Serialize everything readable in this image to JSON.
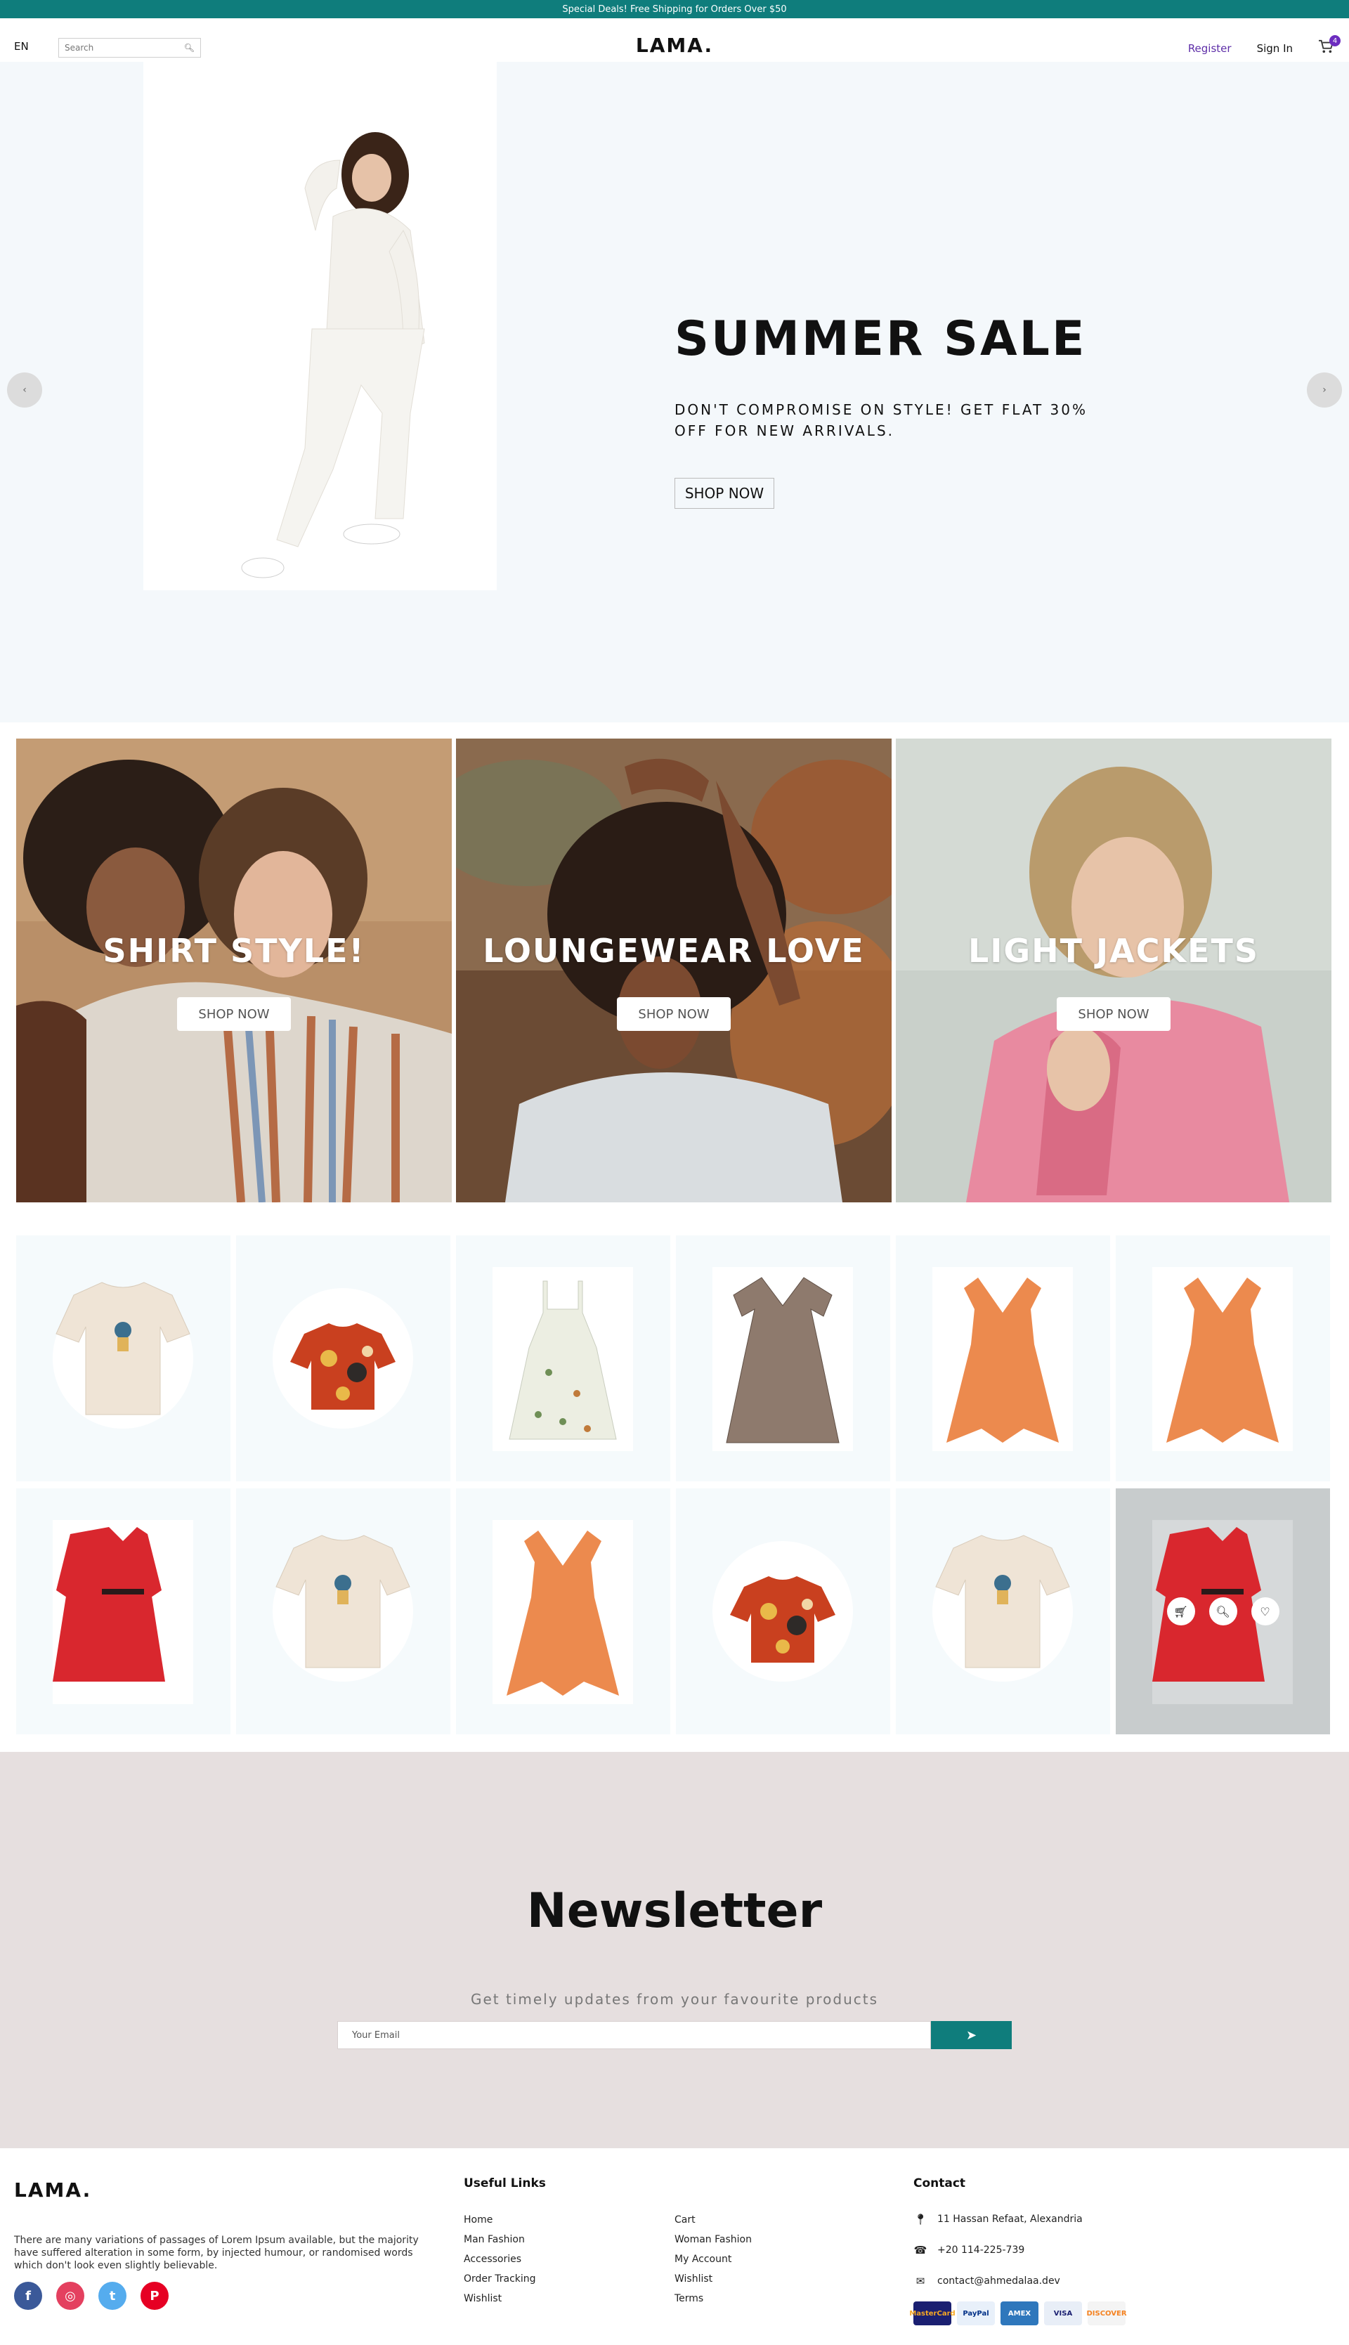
{
  "announcement": "Special Deals! Free Shipping for Orders Over $50",
  "nav": {
    "language": "EN",
    "search_placeholder": "Search",
    "logo": "LAMA.",
    "register": "Register",
    "sign_in": "Sign In",
    "cart_count": "4"
  },
  "hero": {
    "title": "SUMMER SALE",
    "description": "DON'T COMPROMISE ON STYLE! GET FLAT 30% OFF FOR NEW ARRIVALS.",
    "button": "SHOP NOW"
  },
  "categories": [
    {
      "title": "SHIRT STYLE!",
      "button": "SHOP NOW"
    },
    {
      "title": "LOUNGEWEAR LOVE",
      "button": "SHOP NOW"
    },
    {
      "title": "LIGHT JACKETS",
      "button": "SHOP NOW"
    }
  ],
  "products": [
    {
      "icon": "tshirt-product",
      "shape": "circle"
    },
    {
      "icon": "hawaiian-shirt-product",
      "shape": "circle"
    },
    {
      "icon": "floral-dress-product",
      "shape": "square"
    },
    {
      "icon": "printed-wrap-dress-product",
      "shape": "square"
    },
    {
      "icon": "orange-dress-product",
      "shape": "square"
    },
    {
      "icon": "orange-dress-product",
      "shape": "square"
    },
    {
      "icon": "red-coat-dress-product",
      "shape": "square"
    },
    {
      "icon": "tshirt-product",
      "shape": "circle"
    },
    {
      "icon": "orange-dress-product",
      "shape": "square"
    },
    {
      "icon": "hawaiian-shirt-product",
      "shape": "circle"
    },
    {
      "icon": "tshirt-product",
      "shape": "circle"
    },
    {
      "icon": "red-coat-dress-product",
      "shape": "square"
    }
  ],
  "newsletter": {
    "title": "Newsletter",
    "description": "Get timely updates from your favourite products",
    "email_placeholder": "Your Email"
  },
  "footer": {
    "logo": "LAMA.",
    "description": "There are many variations of passages of Lorem Ipsum available, but the majority have suffered alteration in some form, by injected humour, or randomised words which don't look even slightly believable.",
    "useful_links_title": "Useful Links",
    "links": [
      "Home",
      "Cart",
      "Man Fashion",
      "Woman Fashion",
      "Accessories",
      "My Account",
      "Order Tracking",
      "Wishlist",
      "Wishlist",
      "Terms"
    ],
    "contact_title": "Contact",
    "address": "11 Hassan Refaat, Alexandria",
    "phone": "+20 114-225-739",
    "email": "contact@ahmedalaa.dev",
    "payments": [
      "MasterCard",
      "PayPal",
      "AMEX",
      "VISA",
      "DISCOVER"
    ]
  },
  "colors": {
    "teal": "#0f7d7c",
    "purple": "#6c2cbf",
    "hero_bg": "#f4f8fb",
    "newsletter_bg": "#e6dfdf",
    "product_bg": "#f5fafc"
  }
}
